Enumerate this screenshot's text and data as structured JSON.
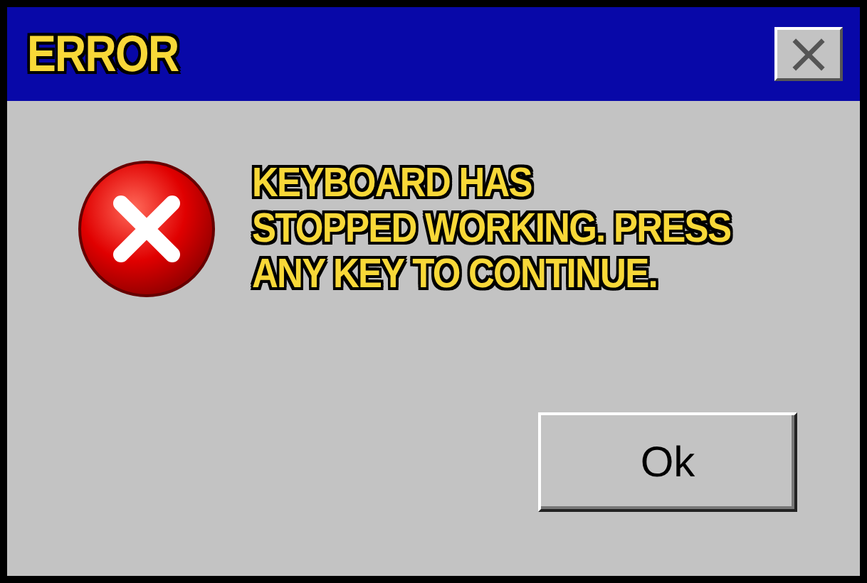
{
  "window": {
    "title": "ERROR",
    "close_glyph": "×"
  },
  "message": {
    "kind": "error",
    "text": "KEYBOARD HAS\nSTOPPED WORKING. PRESS\nANY KEY TO CONTINUE."
  },
  "buttons": [
    "Ok"
  ]
}
